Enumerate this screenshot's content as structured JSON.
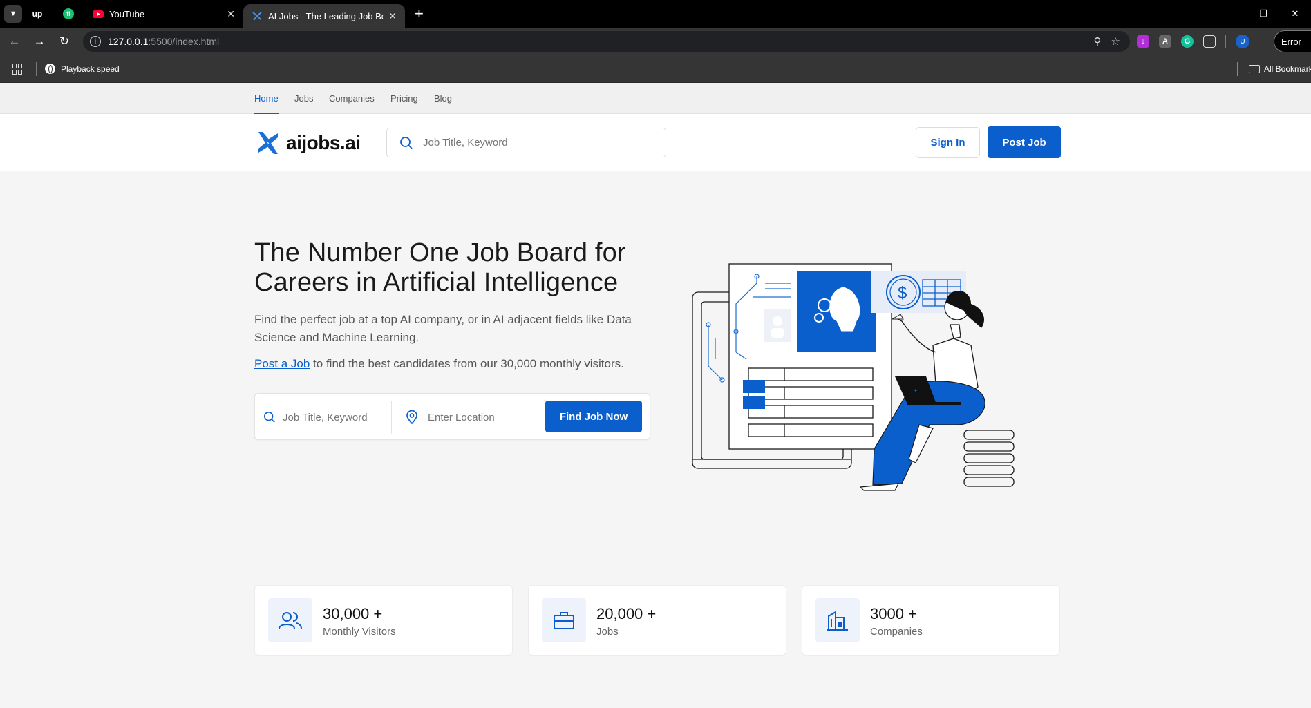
{
  "browser": {
    "tabs": [
      {
        "label": "YouTube",
        "icon": "youtube-icon"
      },
      {
        "label": "AI Jobs - The Leading Job Board",
        "icon": "aijobs-favicon-icon"
      }
    ],
    "pinned": [
      "up",
      "fi"
    ],
    "url_host": "127.0.0.1",
    "url_rest": ":5500/index.html",
    "error_label": "Error",
    "profile_initial": "U",
    "bookmark": "Playback speed",
    "all_bookmarks": "All Bookmarks",
    "ext_a": "A"
  },
  "topnav": {
    "items": [
      "Home",
      "Jobs",
      "Companies",
      "Pricing",
      "Blog"
    ],
    "active": "Home"
  },
  "header": {
    "logo_text": "aijobs.ai",
    "search_placeholder": "Job Title, Keyword",
    "signin_label": "Sign In",
    "postjob_label": "Post Job"
  },
  "hero": {
    "title": "The Number One Job Board for Careers in Artificial Intelligence",
    "subtitle": "Find the perfect job at a top AI company, or in AI adjacent fields like Data Science and Machine Learning.",
    "cta_link": "Post a Job",
    "cta_rest": " to find the best candidates from our 30,000 monthly visitors.",
    "keyword_placeholder": "Job Title, Keyword",
    "location_placeholder": "Enter Location",
    "find_label": "Find Job Now"
  },
  "stats": [
    {
      "value": "30,000 +",
      "label": "Monthly Visitors",
      "icon": "users-icon"
    },
    {
      "value": "20,000 +",
      "label": "Jobs",
      "icon": "briefcase-icon"
    },
    {
      "value": "3000 +",
      "label": "Companies",
      "icon": "building-icon"
    }
  ],
  "colors": {
    "accent": "#0b5fcc",
    "page_bg": "#f5f5f5",
    "chrome_dark": "#353535"
  }
}
